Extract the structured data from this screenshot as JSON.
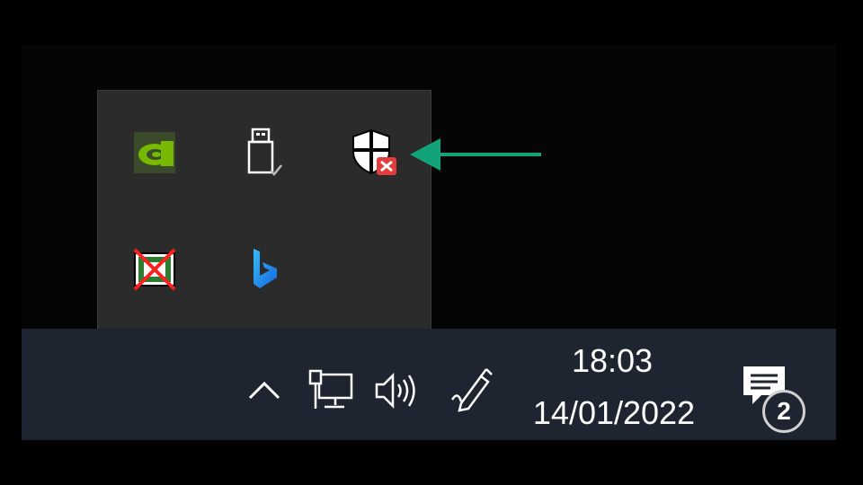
{
  "overflow_tray": {
    "icons": [
      {
        "name": "nvidia-icon",
        "color": "#76b900"
      },
      {
        "name": "usb-safely-remove-icon",
        "color": "#ffffff"
      },
      {
        "name": "security-alert-shield-icon",
        "badge_color": "#e23c3c"
      },
      {
        "name": "disabled-app-icon",
        "color": "#2e7d32"
      },
      {
        "name": "bing-icon",
        "color": "#1a8cff"
      }
    ]
  },
  "annotation": {
    "arrow_color": "#13a37a"
  },
  "taskbar": {
    "show_hidden_icons_icon": "chevron-up-icon",
    "network_icon": "network-monitor-icon",
    "volume_icon": "speaker-icon",
    "pen_icon": "pen-workspace-icon",
    "clock": {
      "time": "18:03",
      "date": "14/01/2022"
    },
    "notifications": {
      "icon": "notification-center-icon",
      "count": "2"
    }
  }
}
